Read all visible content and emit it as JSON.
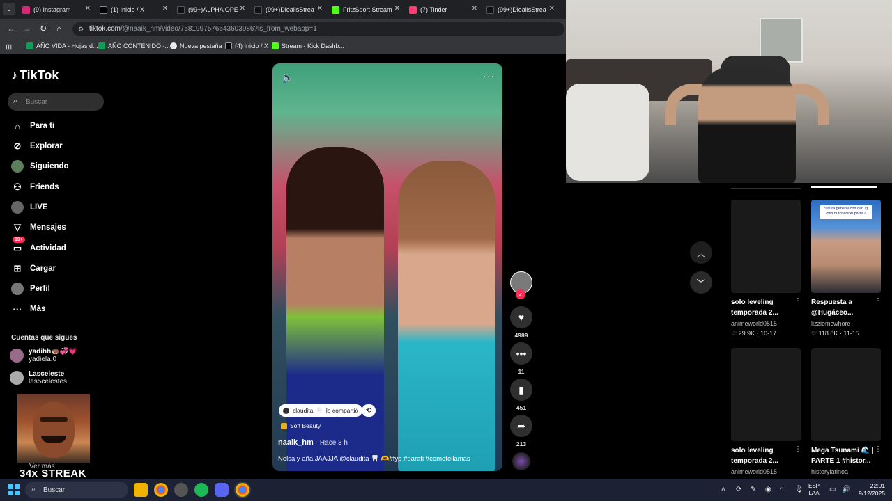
{
  "browser": {
    "tabs": [
      {
        "label": "(9) Instagram",
        "color": "#d62976"
      },
      {
        "label": "(1) Inicio / X",
        "color": "#000000"
      },
      {
        "label": "(99+)ALPHA OPE",
        "color": "#111111"
      },
      {
        "label": "(99+)DiealisStrea",
        "color": "#111111"
      },
      {
        "label": "FritzSport Stream",
        "color": "#53fc18"
      },
      {
        "label": "(7) Tinder",
        "color": "#fe3c72"
      },
      {
        "label": "(99+)DiealisStrea",
        "color": "#111111"
      }
    ],
    "url_host": "tiktok.com",
    "url_path": "/@naaik_hm/video/7581997576543603986?is_from_webapp=1",
    "bookmarks": [
      {
        "label": "AÑO VIDA - Hojas d...",
        "color": "#0f9d58"
      },
      {
        "label": "AÑO CONTENIDO -...",
        "color": "#0f9d58"
      },
      {
        "label": "Nueva pestaña",
        "color": "#e8eaed"
      },
      {
        "label": "(4) Inicio / X",
        "color": "#000000"
      },
      {
        "label": "Stream - Kick Dashb...",
        "color": "#53fc18"
      }
    ]
  },
  "sidebar": {
    "logo": "TikTok",
    "search_placeholder": "Buscar",
    "nav": [
      {
        "label": "Para ti",
        "icon": "home-icon"
      },
      {
        "label": "Explorar",
        "icon": "compass-icon"
      },
      {
        "label": "Siguiendo",
        "icon": "following-icon"
      },
      {
        "label": "Friends",
        "icon": "friends-icon"
      },
      {
        "label": "LIVE",
        "icon": "live-icon"
      },
      {
        "label": "Mensajes",
        "icon": "messages-icon"
      },
      {
        "label": "Actividad",
        "icon": "activity-icon",
        "badge": "99+"
      },
      {
        "label": "Cargar",
        "icon": "upload-icon"
      },
      {
        "label": "Perfil",
        "icon": "profile-icon"
      },
      {
        "label": "Más",
        "icon": "more-icon"
      }
    ],
    "following_title": "Cuentas que sigues",
    "accounts": [
      {
        "name": "yadihh🦔💞💗",
        "user": "yadiela.0"
      },
      {
        "name": "Lasceleste",
        "user": "las5celestes"
      }
    ],
    "see_more": "Ver más"
  },
  "overlay": {
    "streak": "34x STREAK"
  },
  "video": {
    "shared_by": "claudita",
    "shared_text": "lo compartió",
    "effect": "Soft Beauty",
    "author": "naaik_hm",
    "time": "· Hace 3 h",
    "caption": "Nelsa y aña JAAJJA @claudita 🦷 🫶#fyp #parati #comotellamas",
    "likes": "4989",
    "comments": "11",
    "saves": "451",
    "shares": "213"
  },
  "related": [
    {
      "title": "solo leveling temporada 2...",
      "user": "animeworld0515",
      "stats": "♡ 29.9K · 10-17"
    },
    {
      "title": "Respuesta a @Hugáceo...",
      "user": "lizziemcwhore",
      "stats": "♡ 118.8K · 11-15",
      "thumb_caption": "cultura general con dan @ josh hutcherson parte 2"
    },
    {
      "title": "solo leveling temporada 2...",
      "user": "animeworld0515",
      "stats": ""
    },
    {
      "title": "Mega Tsunami 🌊 | PARTE 1 #histor...",
      "user": "historylatinoa",
      "stats": ""
    }
  ],
  "taskbar": {
    "search": "Buscar",
    "lang": "ESP",
    "lang2": "LAA",
    "time": "22:01",
    "date": "9/12/2025"
  }
}
